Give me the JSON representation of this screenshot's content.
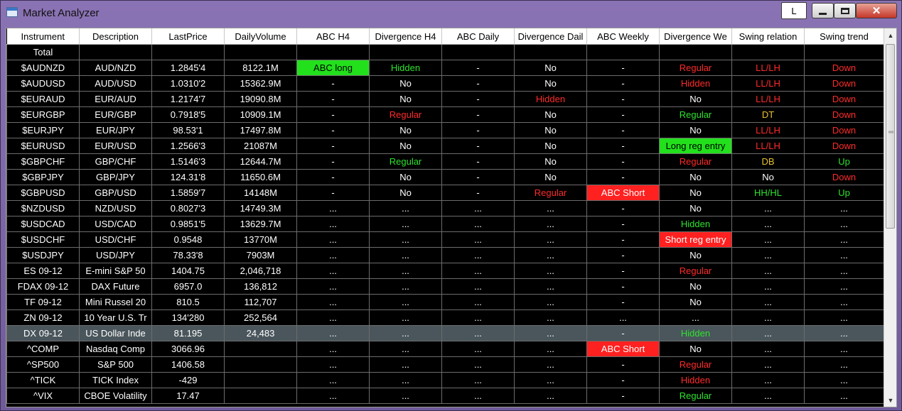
{
  "window": {
    "title": "Market Analyzer",
    "l_button": "L",
    "minimize_icon": "minimize-icon",
    "maximize_icon": "maximize-icon",
    "close_icon": "close-icon",
    "close_glyph": "✕"
  },
  "colors": {
    "green_text": "#2ee22e",
    "red_text": "#ff2a2a",
    "yellow_text": "#e8c030",
    "green_cell": "#22e01c",
    "red_cell": "#ff2020",
    "selected_row": "#4a565c"
  },
  "columns": [
    "Instrument",
    "Description",
    "LastPrice",
    "DailyVolume",
    "ABC H4",
    "Divergence H4",
    "ABC Daily",
    "Divergence Dail",
    "ABC Weekly",
    "Divergence  We",
    "Swing relation",
    "Swing trend"
  ],
  "rows": [
    {
      "cells": [
        "Total",
        "",
        "",
        "",
        "",
        "",
        "",
        "",
        "",
        "",
        "",
        ""
      ],
      "styles": [
        "",
        "",
        "",
        "",
        "",
        "",
        "",
        "",
        "",
        "",
        "",
        ""
      ]
    },
    {
      "cells": [
        "$AUDNZD",
        "AUD/NZD",
        "1.2845'4",
        "8122.1M",
        "ABC long",
        "Hidden",
        "-",
        "No",
        "-",
        "Regular",
        "LL/LH",
        "Down"
      ],
      "styles": [
        "",
        "",
        "",
        "",
        "bg-green",
        "c-green",
        "",
        "",
        "",
        "c-red",
        "c-red",
        "c-red"
      ]
    },
    {
      "cells": [
        "$AUDUSD",
        "AUD/USD",
        "1.0310'2",
        "15362.9M",
        "-",
        "No",
        "-",
        "No",
        "-",
        "Hidden",
        "LL/LH",
        "Down"
      ],
      "styles": [
        "",
        "",
        "",
        "",
        "",
        "",
        "",
        "",
        "",
        "c-red",
        "c-red",
        "c-red"
      ]
    },
    {
      "cells": [
        "$EURAUD",
        "EUR/AUD",
        "1.2174'7",
        "19090.8M",
        "-",
        "No",
        "-",
        "Hidden",
        "-",
        "No",
        "LL/LH",
        "Down"
      ],
      "styles": [
        "",
        "",
        "",
        "",
        "",
        "",
        "",
        "c-red",
        "",
        "",
        "c-red",
        "c-red"
      ]
    },
    {
      "cells": [
        "$EURGBP",
        "EUR/GBP",
        "0.7918'5",
        "10909.1M",
        "-",
        "Regular",
        "-",
        "No",
        "-",
        "Regular",
        "DT",
        "Down"
      ],
      "styles": [
        "",
        "",
        "",
        "",
        "",
        "c-red",
        "",
        "",
        "",
        "c-green",
        "c-yellow",
        "c-red"
      ]
    },
    {
      "cells": [
        "$EURJPY",
        "EUR/JPY",
        "98.53'1",
        "17497.8M",
        "-",
        "No",
        "-",
        "No",
        "-",
        "No",
        "LL/LH",
        "Down"
      ],
      "styles": [
        "",
        "",
        "",
        "",
        "",
        "",
        "",
        "",
        "",
        "",
        "c-red",
        "c-red"
      ]
    },
    {
      "cells": [
        "$EURUSD",
        "EUR/USD",
        "1.2566'3",
        "21087M",
        "-",
        "No",
        "-",
        "No",
        "-",
        "Long reg entry",
        "LL/LH",
        "Down"
      ],
      "styles": [
        "",
        "",
        "",
        "",
        "",
        "",
        "",
        "",
        "",
        "bg-green",
        "c-red",
        "c-red"
      ]
    },
    {
      "cells": [
        "$GBPCHF",
        "GBP/CHF",
        "1.5146'3",
        "12644.7M",
        "-",
        "Regular",
        "-",
        "No",
        "-",
        "Regular",
        "DB",
        "Up"
      ],
      "styles": [
        "",
        "",
        "",
        "",
        "",
        "c-green",
        "",
        "",
        "",
        "c-red",
        "c-yellow",
        "c-green"
      ]
    },
    {
      "cells": [
        "$GBPJPY",
        "GBP/JPY",
        "124.31'8",
        "11650.6M",
        "-",
        "No",
        "-",
        "No",
        "-",
        "No",
        "No",
        "Down"
      ],
      "styles": [
        "",
        "",
        "",
        "",
        "",
        "",
        "",
        "",
        "",
        "",
        "",
        "c-red"
      ]
    },
    {
      "cells": [
        "$GBPUSD",
        "GBP/USD",
        "1.5859'7",
        "14148M",
        "-",
        "No",
        "-",
        "Regular",
        "ABC Short",
        "No",
        "HH/HL",
        "Up"
      ],
      "styles": [
        "",
        "",
        "",
        "",
        "",
        "",
        "",
        "c-red",
        "bg-red",
        "",
        "c-green",
        "c-green"
      ]
    },
    {
      "cells": [
        "$NZDUSD",
        "NZD/USD",
        "0.8027'3",
        "14749.3M",
        "...",
        "...",
        "...",
        "...",
        "-",
        "No",
        "...",
        "..."
      ],
      "styles": [
        "",
        "",
        "",
        "",
        "",
        "",
        "",
        "",
        "",
        "",
        "",
        ""
      ]
    },
    {
      "cells": [
        "$USDCAD",
        "USD/CAD",
        "0.9851'5",
        "13629.7M",
        "...",
        "...",
        "...",
        "...",
        "-",
        "Hidden",
        "...",
        "..."
      ],
      "styles": [
        "",
        "",
        "",
        "",
        "",
        "",
        "",
        "",
        "",
        "c-green",
        "",
        ""
      ]
    },
    {
      "cells": [
        "$USDCHF",
        "USD/CHF",
        "0.9548",
        "13770M",
        "...",
        "...",
        "...",
        "...",
        "-",
        "Short reg entry",
        "...",
        "..."
      ],
      "styles": [
        "",
        "",
        "",
        "",
        "",
        "",
        "",
        "",
        "",
        "bg-red",
        "",
        ""
      ]
    },
    {
      "cells": [
        "$USDJPY",
        "USD/JPY",
        "78.33'8",
        "7903M",
        "...",
        "...",
        "...",
        "...",
        "-",
        "No",
        "...",
        "..."
      ],
      "styles": [
        "",
        "",
        "",
        "",
        "",
        "",
        "",
        "",
        "",
        "",
        "",
        ""
      ]
    },
    {
      "cells": [
        "ES 09-12",
        "E-mini S&P 50",
        "1404.75",
        "2,046,718",
        "...",
        "...",
        "...",
        "...",
        "-",
        "Regular",
        "...",
        "..."
      ],
      "styles": [
        "",
        "",
        "",
        "",
        "",
        "",
        "",
        "",
        "",
        "c-red",
        "",
        ""
      ]
    },
    {
      "cells": [
        "FDAX 09-12",
        "DAX Future",
        "6957.0",
        "136,812",
        "...",
        "...",
        "...",
        "...",
        "-",
        "No",
        "...",
        "..."
      ],
      "styles": [
        "",
        "",
        "",
        "",
        "",
        "",
        "",
        "",
        "",
        "",
        "",
        ""
      ]
    },
    {
      "cells": [
        "TF 09-12",
        "Mini Russel 20",
        "810.5",
        "112,707",
        "...",
        "...",
        "...",
        "...",
        "-",
        "No",
        "...",
        "..."
      ],
      "styles": [
        "",
        "",
        "",
        "",
        "",
        "",
        "",
        "",
        "",
        "",
        "",
        ""
      ]
    },
    {
      "cells": [
        "ZN 09-12",
        "10 Year U.S. Tr",
        "134'280",
        "252,564",
        "...",
        "...",
        "...",
        "...",
        "...",
        "...",
        "...",
        "..."
      ],
      "styles": [
        "",
        "",
        "",
        "",
        "",
        "",
        "",
        "",
        "",
        "",
        "",
        ""
      ]
    },
    {
      "cells": [
        "DX 09-12",
        "US Dollar Inde",
        "81.195",
        "24,483",
        "...",
        "...",
        "...",
        "...",
        "-",
        "Hidden",
        "...",
        "..."
      ],
      "styles": [
        "",
        "",
        "",
        "",
        "",
        "",
        "",
        "",
        "",
        "c-green",
        "",
        ""
      ],
      "selected": true
    },
    {
      "cells": [
        "^COMP",
        "Nasdaq Comp",
        "3066.96",
        "",
        "...",
        "...",
        "...",
        "...",
        "ABC Short",
        "No",
        "...",
        "..."
      ],
      "styles": [
        "",
        "",
        "",
        "",
        "",
        "",
        "",
        "",
        "bg-red",
        "",
        "",
        ""
      ]
    },
    {
      "cells": [
        "^SP500",
        "S&P 500",
        "1406.58",
        "",
        "...",
        "...",
        "...",
        "...",
        "-",
        "Regular",
        "...",
        "..."
      ],
      "styles": [
        "",
        "",
        "",
        "",
        "",
        "",
        "",
        "",
        "",
        "c-red",
        "",
        ""
      ]
    },
    {
      "cells": [
        "^TICK",
        "TICK Index",
        "-429",
        "",
        "...",
        "...",
        "...",
        "...",
        "-",
        "Hidden",
        "...",
        "..."
      ],
      "styles": [
        "",
        "",
        "",
        "",
        "",
        "",
        "",
        "",
        "",
        "c-red",
        "",
        ""
      ]
    },
    {
      "cells": [
        "^VIX",
        "CBOE Volatility",
        "17.47",
        "",
        "...",
        "...",
        "...",
        "...",
        "-",
        "Regular",
        "...",
        "..."
      ],
      "styles": [
        "",
        "",
        "",
        "",
        "",
        "",
        "",
        "",
        "",
        "c-green",
        "",
        ""
      ]
    }
  ],
  "scrollbar": {
    "up_icon": "scroll-up-arrow-icon",
    "down_icon": "scroll-down-arrow-icon",
    "up_glyph": "▲",
    "down_glyph": "▼"
  }
}
